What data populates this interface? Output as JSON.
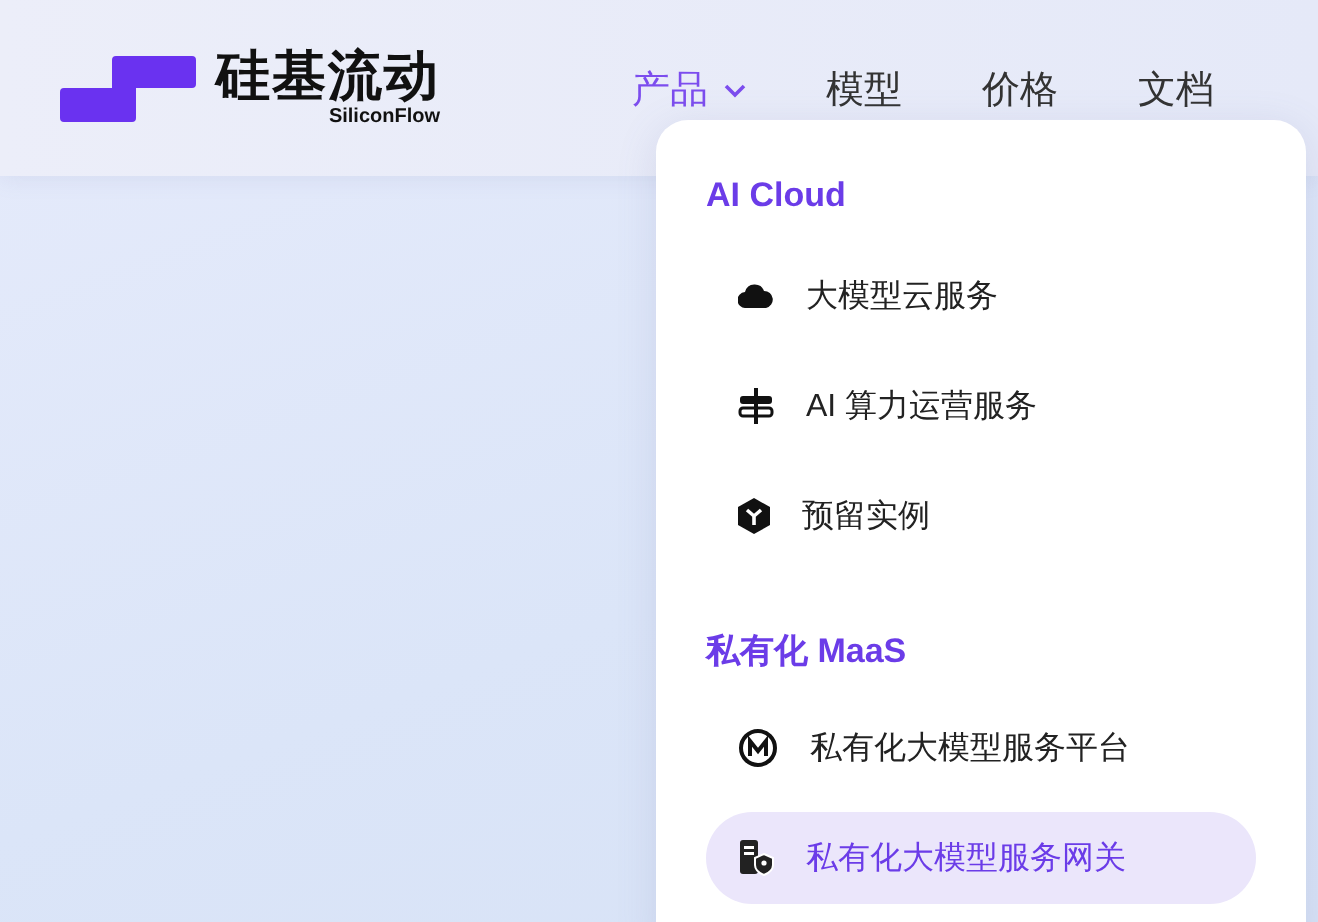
{
  "logo": {
    "name": "硅基流动",
    "subtitle": "SiliconFlow"
  },
  "nav": [
    {
      "label": "产品",
      "selected": true,
      "dropdown": true
    },
    {
      "label": "模型",
      "selected": false,
      "dropdown": false
    },
    {
      "label": "价格",
      "selected": false,
      "dropdown": false
    },
    {
      "label": "文档",
      "selected": false,
      "dropdown": false
    }
  ],
  "menu": {
    "sections": [
      {
        "title": "AI Cloud",
        "items": [
          {
            "label": "大模型云服务",
            "kind": "cloud",
            "selected": false
          },
          {
            "label": "AI 算力运营服务",
            "kind": "server",
            "selected": false
          },
          {
            "label": "预留实例",
            "kind": "hexagon",
            "selected": false
          }
        ]
      },
      {
        "title": "私有化 MaaS",
        "items": [
          {
            "label": "私有化大模型服务平台",
            "kind": "badge",
            "selected": false
          },
          {
            "label": "私有化大模型服务网关",
            "kind": "gateway",
            "selected": true
          }
        ]
      }
    ]
  }
}
